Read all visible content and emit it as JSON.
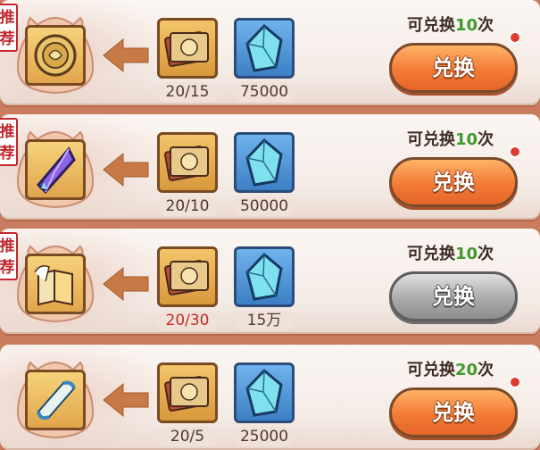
{
  "rows": [
    {
      "recommended": true,
      "tag_chars": [
        "推",
        "荐"
      ],
      "reward": "coin-icon",
      "card_count": "20/15",
      "card_count_red": false,
      "crystal_amount": "75000",
      "limit_prefix": "可兑换",
      "limit_num": "10",
      "limit_suffix": "次",
      "button": "兑换",
      "button_enabled": true,
      "red_dot": true
    },
    {
      "recommended": true,
      "tag_chars": [
        "推",
        "荐"
      ],
      "reward": "purple-crystal-icon",
      "card_count": "20/10",
      "card_count_red": false,
      "crystal_amount": "50000",
      "limit_prefix": "可兑换",
      "limit_num": "10",
      "limit_suffix": "次",
      "button": "兑换",
      "button_enabled": true,
      "red_dot": true
    },
    {
      "recommended": true,
      "tag_chars": [
        "推",
        "荐"
      ],
      "reward": "book-scroll-icon",
      "card_count": "20/30",
      "card_count_red": true,
      "crystal_amount": "15万",
      "limit_prefix": "可兑换",
      "limit_num": "10",
      "limit_suffix": "次",
      "button": "兑换",
      "button_enabled": false,
      "red_dot": false
    },
    {
      "recommended": false,
      "tag_chars": [],
      "reward": "scroll-icon",
      "card_count": "20/5",
      "card_count_red": false,
      "crystal_amount": "25000",
      "limit_prefix": "可兑换",
      "limit_num": "20",
      "limit_suffix": "次",
      "button": "兑换",
      "button_enabled": true,
      "red_dot": true
    }
  ],
  "colors": {
    "count_green": "#3f9a2c",
    "insufficient_red": "#c62a2a",
    "button_orange": "#f27b36",
    "button_gray": "#a6a6a6"
  }
}
